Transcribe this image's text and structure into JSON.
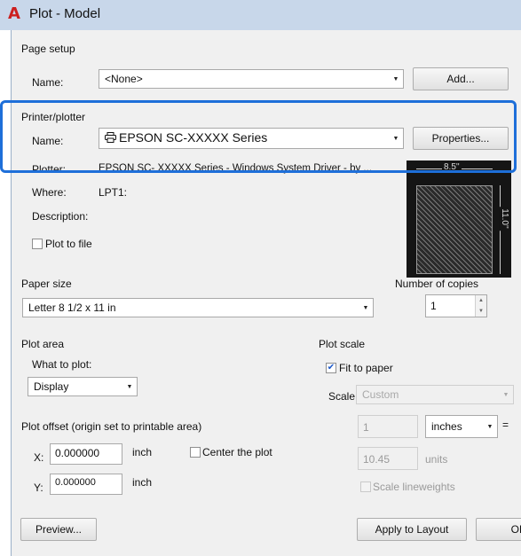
{
  "window": {
    "title": "Plot - Model",
    "logo": "A"
  },
  "page_setup": {
    "section": "Page setup",
    "name_label": "Name:",
    "name_value": "<None>",
    "add_button": "Add..."
  },
  "printer": {
    "section": "Printer/plotter",
    "name_label": "Name:",
    "name_value": "EPSON SC-XXXXX   Series",
    "properties_button": "Properties...",
    "plotter_label": "Plotter:",
    "plotter_value": "EPSON SC- XXXXX Series - Windows System Driver - by ...",
    "where_label": "Where:",
    "where_value": "LPT1:",
    "description_label": "Description:",
    "plot_to_file_label": "Plot to file",
    "plot_to_file_checked": false
  },
  "paper_preview": {
    "width_label": "8.5''",
    "height_label": "11.0''"
  },
  "paper_size": {
    "section": "Paper size",
    "value": "Letter 8 1/2 x 11 in"
  },
  "copies": {
    "section": "Number of copies",
    "value": "1"
  },
  "plot_area": {
    "section": "Plot area",
    "what_label": "What to plot:",
    "what_value": "Display"
  },
  "plot_scale": {
    "section": "Plot scale",
    "fit_label": "Fit to paper",
    "fit_checked": true,
    "scale_label": "Scale:",
    "scale_value": "Custom",
    "value1": "1",
    "unit1": "inches",
    "equals": "=",
    "value2": "10.45",
    "unit2": "units",
    "lineweights_label": "Scale lineweights"
  },
  "plot_offset": {
    "section": "Plot offset (origin set to printable area)",
    "x_label": "X:",
    "x_value": "0.000000",
    "x_unit": "inch",
    "y_label": "Y:",
    "y_value": "0.000000",
    "y_unit": "inch",
    "center_label": "Center the plot"
  },
  "footer": {
    "preview_button": "Preview...",
    "apply_button": "Apply to Layout",
    "ok_button": "OK"
  },
  "icons": {
    "printer": "printer-icon",
    "dropdown": "dropdown-arrow-icon",
    "check": "checkmark-icon"
  },
  "colors": {
    "highlight": "#1e6fd9",
    "title_bar": "#c8d7ea",
    "logo": "#cc1f1f"
  }
}
